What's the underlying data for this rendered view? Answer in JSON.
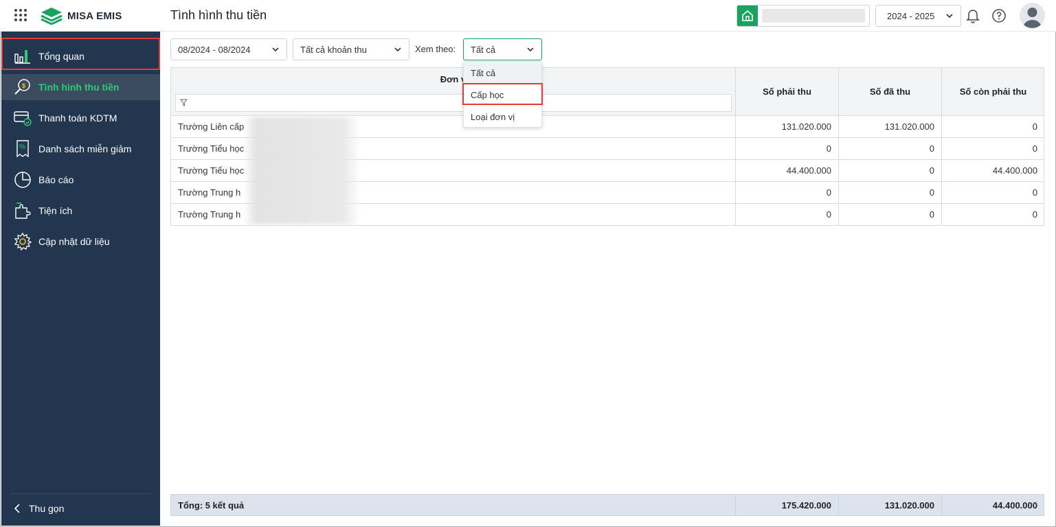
{
  "app": {
    "brand": "MISA EMIS",
    "page_title": "Tình hình thu tiền",
    "school_year": "2024 - 2025"
  },
  "sidebar": {
    "items": [
      {
        "label": "Tổng quan",
        "icon": "chart-bars-icon"
      },
      {
        "label": "Tình hình thu tiền",
        "icon": "money-search-icon",
        "active": true
      },
      {
        "label": "Thanh toán KDTM",
        "icon": "card-check-icon"
      },
      {
        "label": "Danh sách miễn giảm",
        "icon": "discount-receipt-icon"
      },
      {
        "label": "Báo cáo",
        "icon": "pie-chart-icon"
      },
      {
        "label": "Tiện ích",
        "icon": "puzzle-icon"
      },
      {
        "label": "Cập nhật dữ liệu",
        "icon": "gear-icon"
      }
    ],
    "collapse_label": "Thu gọn"
  },
  "filters": {
    "period": "08/2024 - 08/2024",
    "fee_type": "Tất cả khoản thu",
    "view_by_label": "Xem theo:",
    "view_by_value": "Tất cả"
  },
  "dropdown": {
    "options": [
      "Tất cả",
      "Cấp học",
      "Loại đơn vị"
    ],
    "selected": "Tất cả",
    "highlighted": "Cấp học"
  },
  "table": {
    "columns": [
      "Đơn v",
      "Số phải thu",
      "Số đã thu",
      "Số còn phải thu"
    ],
    "rows": [
      {
        "name": "Trường Liên cấp",
        "phai_thu": "131.020.000",
        "da_thu": "131.020.000",
        "con_phai_thu": "0"
      },
      {
        "name": "Trường Tiểu học",
        "phai_thu": "0",
        "da_thu": "0",
        "con_phai_thu": "0"
      },
      {
        "name": "Trường Tiểu học",
        "phai_thu": "44.400.000",
        "da_thu": "0",
        "con_phai_thu": "44.400.000"
      },
      {
        "name": "Trường Trung h",
        "phai_thu": "0",
        "da_thu": "0",
        "con_phai_thu": "0"
      },
      {
        "name": "Trường Trung h",
        "phai_thu": "0",
        "da_thu": "0",
        "con_phai_thu": "0"
      }
    ],
    "footer": {
      "label": "Tổng: 5 kết quả",
      "phai_thu": "175.420.000",
      "da_thu": "131.020.000",
      "con_phai_thu": "44.400.000"
    }
  },
  "colors": {
    "sidebar_bg": "#22364f",
    "active_text": "#2ecc71",
    "brand_green": "#1aa260",
    "highlight_red": "#e53935"
  }
}
